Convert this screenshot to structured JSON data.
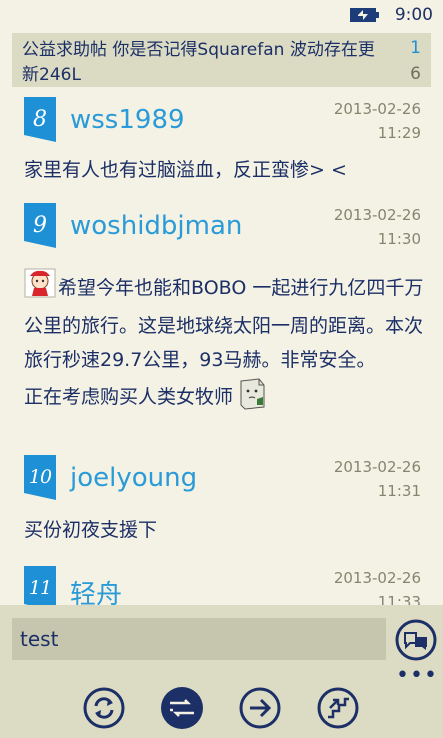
{
  "status": {
    "time": "9:00"
  },
  "thread": {
    "title": "公益求助帖 你是否记得Squarefan 波动存在更新246L",
    "page_current": "1",
    "page_total": "6"
  },
  "posts": [
    {
      "floor": "8",
      "author": "wss1989",
      "date": "2013-02-26",
      "time": "11:29",
      "content": "家里有人也有过脑溢血，反正蛮惨> <"
    },
    {
      "floor": "9",
      "author": "woshidbjman",
      "date": "2013-02-26",
      "time": "11:30",
      "content": "希望今年也能和BOBO 一起进行九亿四千万公里的旅行。这是地球绕太阳一周的距离。本次旅行秒速29.7公里，93马赫。非常安全。",
      "content2": "正在考虑购买人类女牧师"
    },
    {
      "floor": "10",
      "author": "joelyoung",
      "date": "2013-02-26",
      "time": "11:31",
      "content": "买份初夜支援下"
    },
    {
      "floor": "11",
      "author": "轻舟",
      "date": "2013-02-26",
      "time": "11:33"
    }
  ],
  "reply": {
    "value": "test"
  },
  "appbar": {
    "more": "•••"
  },
  "colors": {
    "accent": "#1e90d6",
    "text": "#1c2f66",
    "background": "#f4f2e4",
    "appbar": "#dcdcc4"
  },
  "icons": [
    "battery-icon",
    "send-icon",
    "refresh-icon",
    "switch-icon",
    "next-icon",
    "jump-icon"
  ]
}
